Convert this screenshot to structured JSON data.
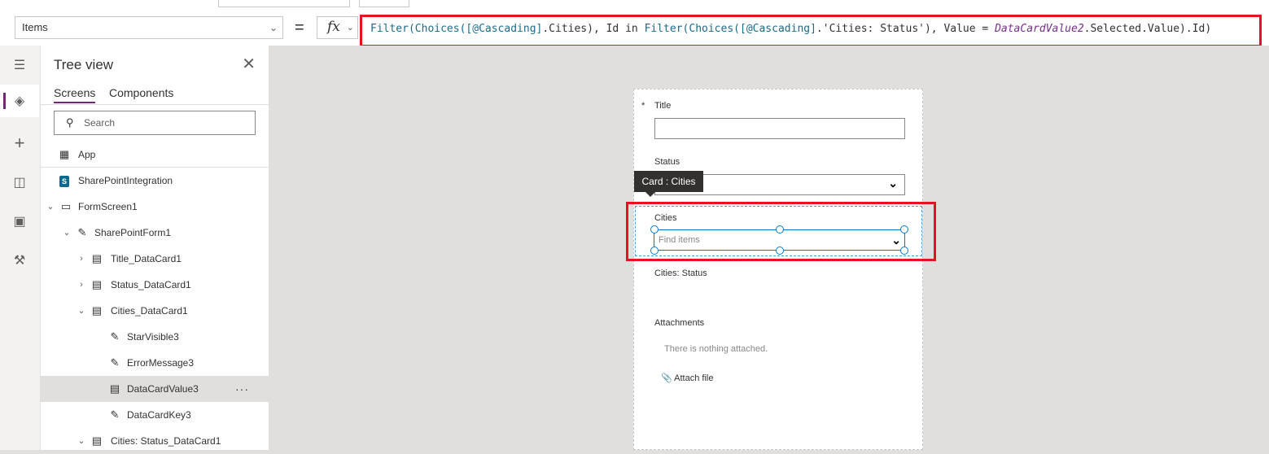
{
  "formula_bar": {
    "property": "Items",
    "equals": "=",
    "fx": "fx",
    "formula_parts": [
      {
        "t": "Filter(",
        "c": "fn"
      },
      {
        "t": "Choices(",
        "c": "fn"
      },
      {
        "t": "[@Cascading]",
        "c": "ref"
      },
      {
        "t": ".Cities), Id in ",
        "c": "kw"
      },
      {
        "t": "Filter(",
        "c": "fn"
      },
      {
        "t": "Choices(",
        "c": "fn"
      },
      {
        "t": "[@Cascading]",
        "c": "ref"
      },
      {
        "t": ".'Cities: Status'), Value = ",
        "c": "kw"
      },
      {
        "t": "DataCardValue2",
        "c": "var"
      },
      {
        "t": ".Selected.Value).Id)",
        "c": "kw"
      }
    ]
  },
  "tree_view": {
    "title": "Tree view",
    "tabs": [
      "Screens",
      "Components"
    ],
    "search_placeholder": "Search",
    "app_label": "App",
    "nodes": {
      "sharepoint": "SharePointIntegration",
      "formscreen": "FormScreen1",
      "form": "SharePointForm1",
      "title_card": "Title_DataCard1",
      "status_card": "Status_DataCard1",
      "cities_card": "Cities_DataCard1",
      "star": "StarVisible3",
      "error": "ErrorMessage3",
      "value": "DataCardValue3",
      "key": "DataCardKey3",
      "cities_status_card": "Cities: Status_DataCard1"
    },
    "more": "···"
  },
  "form": {
    "required_star": "*",
    "title_label": "Title",
    "status_label": "Status",
    "tooltip": "Card : Cities",
    "cities_label": "Cities",
    "cities_placeholder": "Find items",
    "cities_status_label": "Cities: Status",
    "attachments_label": "Attachments",
    "attachments_empty": "There is nothing attached.",
    "attach_file": "Attach file"
  },
  "colors": {
    "accent": "#742774",
    "highlight_red": "#e81123",
    "selection_blue": "#0078d4"
  }
}
